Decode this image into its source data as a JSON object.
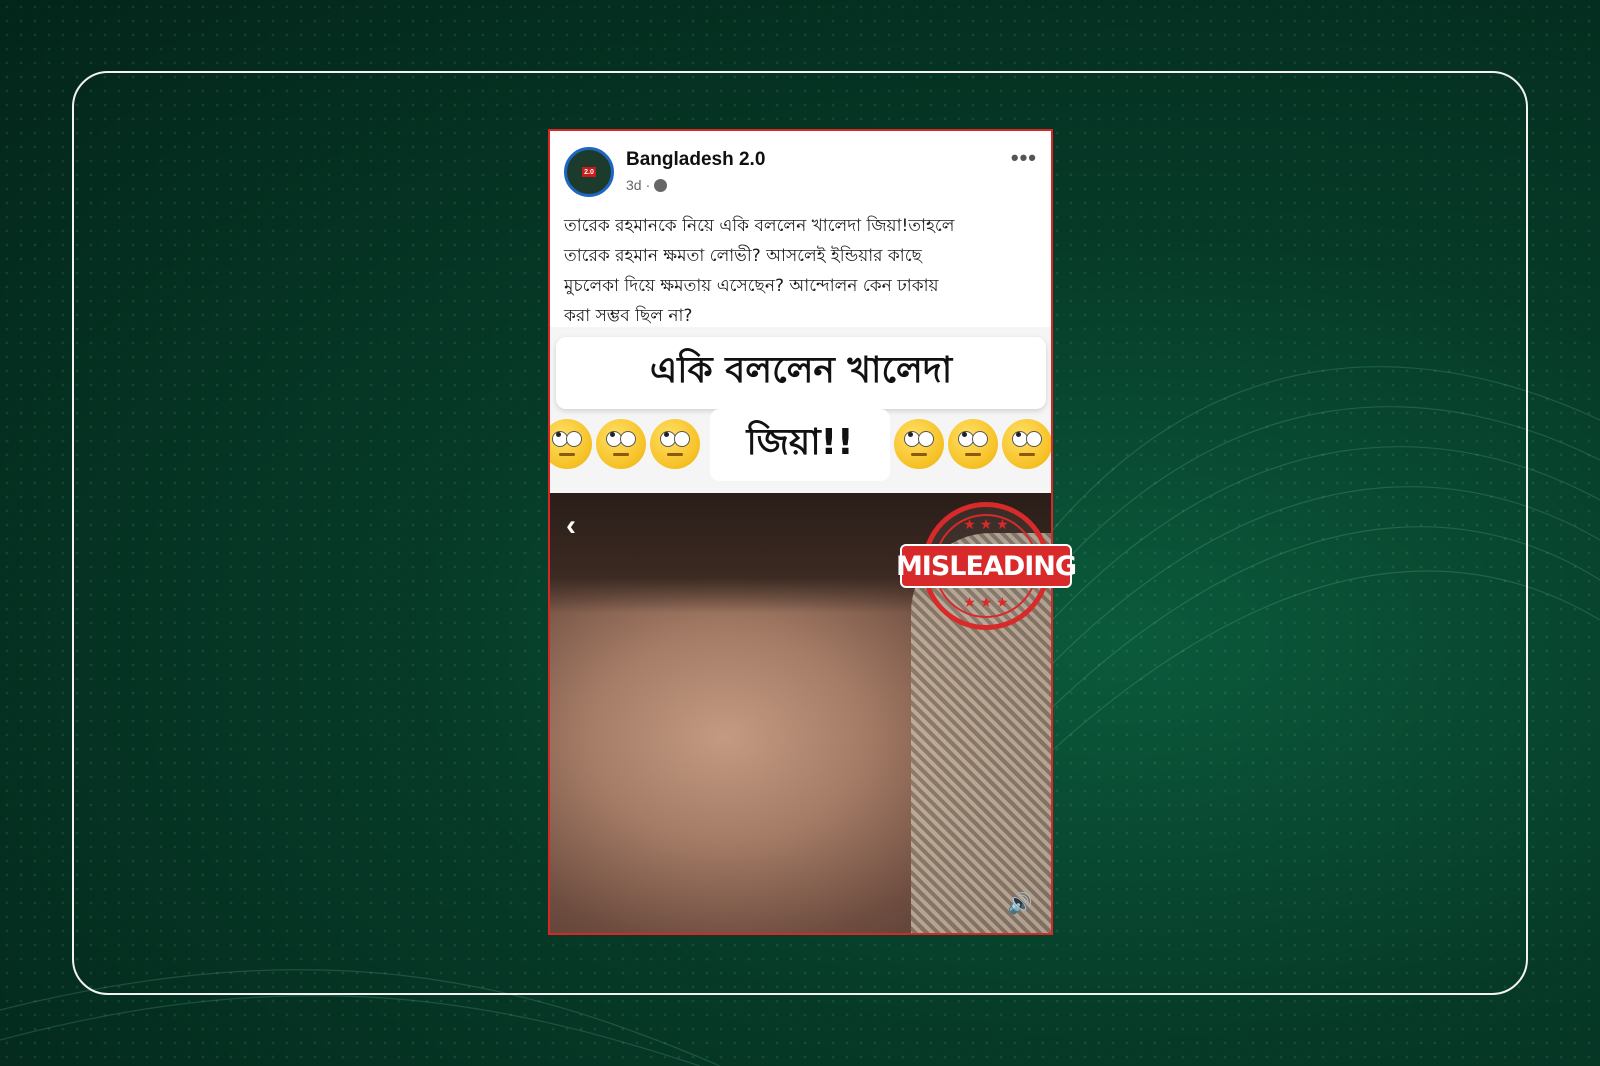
{
  "post": {
    "page_name": "Bangladesh 2.0",
    "avatar_text": "2.0",
    "time": "3d",
    "separator": "·",
    "more": "•••",
    "caption_lines": [
      "তারেক রহমানকে নিয়ে একি বললেন খালেদা জিয়া!তাহলে",
      "তারেক রহমান ক্ষমতা লোভী? আসলেই ইন্ডিয়ার কাছে",
      "মুচলেকা দিয়ে ক্ষমতায় এসেছেন? আন্দোলন কেন ঢাকায়",
      "করা সম্ভব ছিল না?"
    ]
  },
  "media": {
    "title_line1": "একি বললেন খালেদা",
    "title_line2": "জিয়া!!",
    "back_glyph": "‹",
    "volume_glyph": "🔊"
  },
  "stamp": {
    "label": "MISLEADING",
    "stars_top": "★ ★ ★",
    "stars_bottom": "★ ★ ★",
    "color": "#d82a2a"
  },
  "colors": {
    "background": "#063a27",
    "post_border": "#d92727",
    "frame_border": "#f2f2f2"
  }
}
